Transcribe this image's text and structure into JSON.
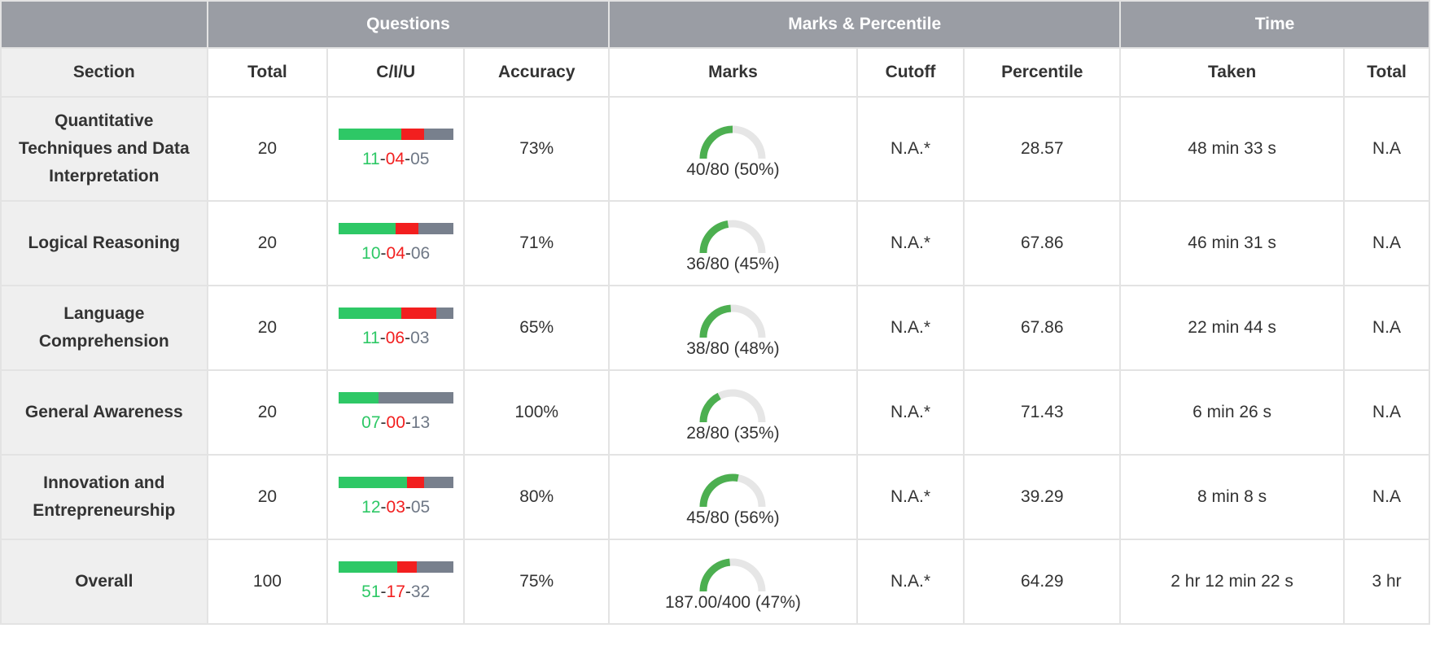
{
  "colors": {
    "correct": "#2ec866",
    "incorrect": "#f21f1f",
    "unattempted": "#78808d",
    "header_bg": "#9a9da4",
    "gauge_fill": "#4caf50",
    "gauge_track": "#e6e6e6"
  },
  "groups": {
    "questions": "Questions",
    "marks_percentile": "Marks & Percentile",
    "time": "Time"
  },
  "columns": {
    "section": "Section",
    "total": "Total",
    "ciu": "C/I/U",
    "accuracy": "Accuracy",
    "marks": "Marks",
    "cutoff": "Cutoff",
    "percentile": "Percentile",
    "taken": "Taken",
    "time_total": "Total"
  },
  "rows": [
    {
      "section": "Quantitative Techniques and Data Interpretation",
      "total": "20",
      "c": "11",
      "i": "04",
      "u": "05",
      "accuracy": "73%",
      "marks_label": "40/80 (50%)",
      "marks_pct": 50,
      "cutoff": "N.A.*",
      "percentile": "28.57",
      "taken": "48 min 33 s",
      "time_total": "N.A"
    },
    {
      "section": "Logical Reasoning",
      "total": "20",
      "c": "10",
      "i": "04",
      "u": "06",
      "accuracy": "71%",
      "marks_label": "36/80 (45%)",
      "marks_pct": 45,
      "cutoff": "N.A.*",
      "percentile": "67.86",
      "taken": "46 min 31 s",
      "time_total": "N.A"
    },
    {
      "section": "Language Comprehension",
      "total": "20",
      "c": "11",
      "i": "06",
      "u": "03",
      "accuracy": "65%",
      "marks_label": "38/80 (48%)",
      "marks_pct": 48,
      "cutoff": "N.A.*",
      "percentile": "67.86",
      "taken": "22 min 44 s",
      "time_total": "N.A"
    },
    {
      "section": "General Awareness",
      "total": "20",
      "c": "07",
      "i": "00",
      "u": "13",
      "accuracy": "100%",
      "marks_label": "28/80 (35%)",
      "marks_pct": 35,
      "cutoff": "N.A.*",
      "percentile": "71.43",
      "taken": "6 min 26 s",
      "time_total": "N.A"
    },
    {
      "section": "Innovation and Entrepreneurship",
      "total": "20",
      "c": "12",
      "i": "03",
      "u": "05",
      "accuracy": "80%",
      "marks_label": "45/80 (56%)",
      "marks_pct": 56,
      "cutoff": "N.A.*",
      "percentile": "39.29",
      "taken": "8 min 8 s",
      "time_total": "N.A"
    },
    {
      "section": "Overall",
      "total": "100",
      "c": "51",
      "i": "17",
      "u": "32",
      "accuracy": "75%",
      "marks_label": "187.00/400 (47%)",
      "marks_pct": 47,
      "cutoff": "N.A.*",
      "percentile": "64.29",
      "taken": "2 hr 12 min 22 s",
      "time_total": "3 hr"
    }
  ]
}
